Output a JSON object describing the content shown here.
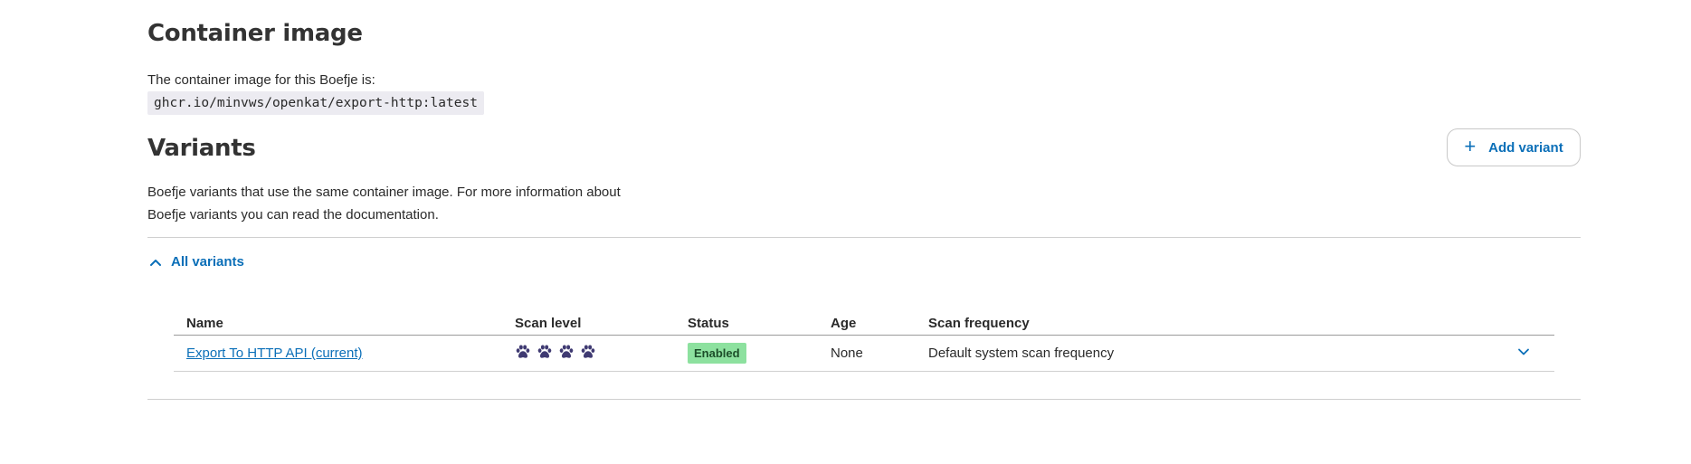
{
  "container_section": {
    "heading": "Container image",
    "intro": "The container image for this Boefje is:",
    "image": "ghcr.io/minvws/openkat/export-http:latest"
  },
  "variants_section": {
    "heading": "Variants",
    "add_button_icon": "plus-icon",
    "add_button_label": "Add variant",
    "description": "Boefje variants that use the same container image. For more information about Boefje variants you can read the documentation.",
    "toggle_label": "All variants",
    "toggle_icon": "chevron-up-icon"
  },
  "table": {
    "columns": [
      "Name",
      "Scan level",
      "Status",
      "Age",
      "Scan frequency"
    ],
    "rows": [
      {
        "name": "Export To HTTP API (current)",
        "scan_level": 4,
        "scan_level_icon": "paw-icon",
        "status": "Enabled",
        "age": "None",
        "scan_frequency": "Default system scan frequency",
        "expand_icon": "chevron-down-icon"
      }
    ]
  },
  "colors": {
    "link": "#0b6fb8",
    "paw": "#3f3a72",
    "enabled_badge_bg": "#8de19f",
    "enabled_badge_text": "#1c4d29",
    "code_bg": "#ecebf1"
  }
}
